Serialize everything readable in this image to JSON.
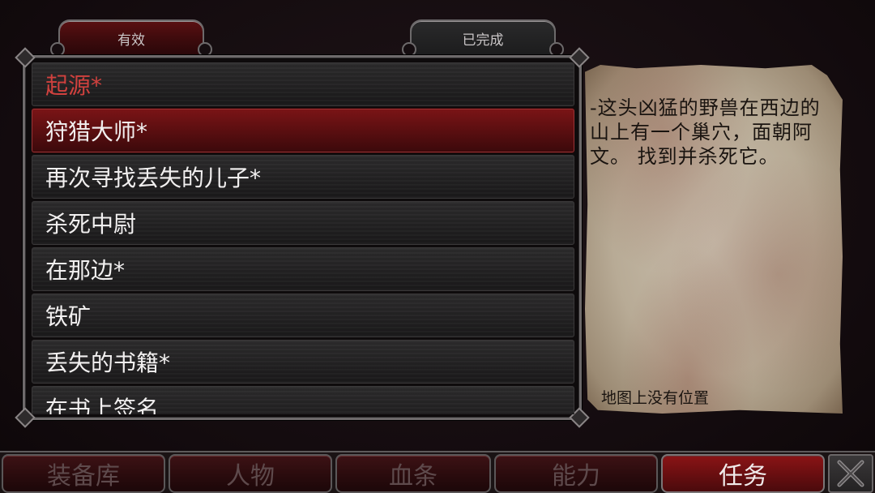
{
  "tabs": {
    "active_label": "有效",
    "completed_label": "已完成"
  },
  "quests": [
    {
      "label": "起源*"
    },
    {
      "label": "狩猎大师*"
    },
    {
      "label": "再次寻找丢失的儿子*"
    },
    {
      "label": "杀死中尉"
    },
    {
      "label": "在那边*"
    },
    {
      "label": "铁矿"
    },
    {
      "label": "丢失的书籍*"
    },
    {
      "label": "在书上签名"
    }
  ],
  "detail": {
    "description": "-这头凶猛的野兽在西边的山上有一个巢穴，面朝阿文。 找到并杀死它。",
    "location_note": "地图上没有位置"
  },
  "nav": {
    "inventory": "装备库",
    "character": "人物",
    "bloodline": "血条",
    "abilities": "能力",
    "quests": "任务"
  },
  "colors": {
    "selected_row": "#6e0f11",
    "highlight_text": "#d0413e",
    "parchment": "#c9bfae"
  },
  "icons": {
    "close": "close-icon"
  }
}
